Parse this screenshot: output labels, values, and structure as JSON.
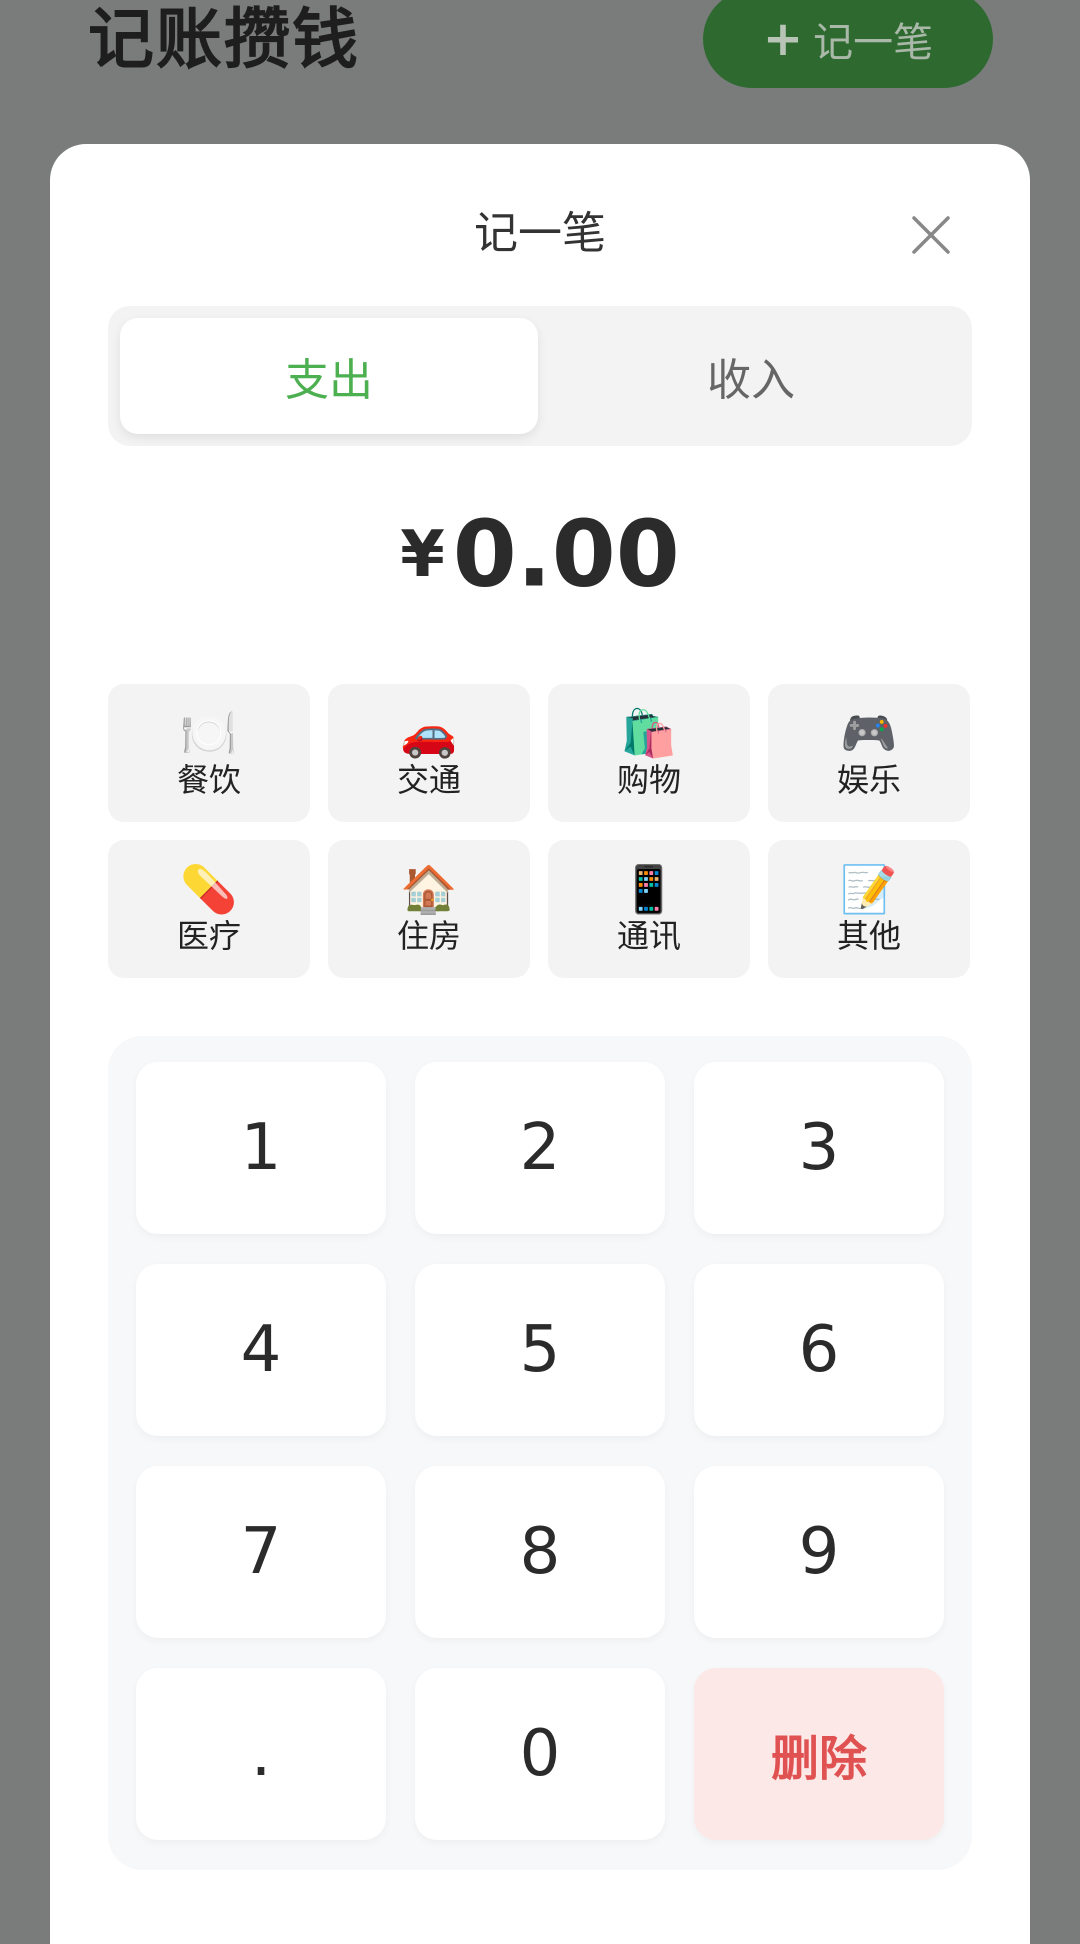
{
  "background": {
    "app_title": "记账攒钱",
    "add_button_label": "记一笔",
    "add_button_icon": "plus-icon"
  },
  "sheet": {
    "title": "记一笔",
    "close_icon": "close-icon"
  },
  "type_tabs": {
    "expense_label": "支出",
    "income_label": "收入",
    "selected": "支出"
  },
  "amount": {
    "currency": "¥",
    "value": "0.00"
  },
  "categories": [
    {
      "icon": "🍽️",
      "label": "餐饮"
    },
    {
      "icon": "🚗",
      "label": "交通"
    },
    {
      "icon": "🛍️",
      "label": "购物"
    },
    {
      "icon": "🎮",
      "label": "娱乐"
    },
    {
      "icon": "💊",
      "label": "医疗"
    },
    {
      "icon": "🏠",
      "label": "住房"
    },
    {
      "icon": "📱",
      "label": "通讯"
    },
    {
      "icon": "📝",
      "label": "其他"
    }
  ],
  "keypad": {
    "keys": [
      "1",
      "2",
      "3",
      "4",
      "5",
      "6",
      "7",
      "8",
      "9",
      ".",
      "0"
    ],
    "delete_label": "删除"
  },
  "colors": {
    "accent_green": "#4caf50",
    "delete_red": "#e05252",
    "delete_bg": "#fde8e8",
    "overlay": "#7a7c7b"
  }
}
